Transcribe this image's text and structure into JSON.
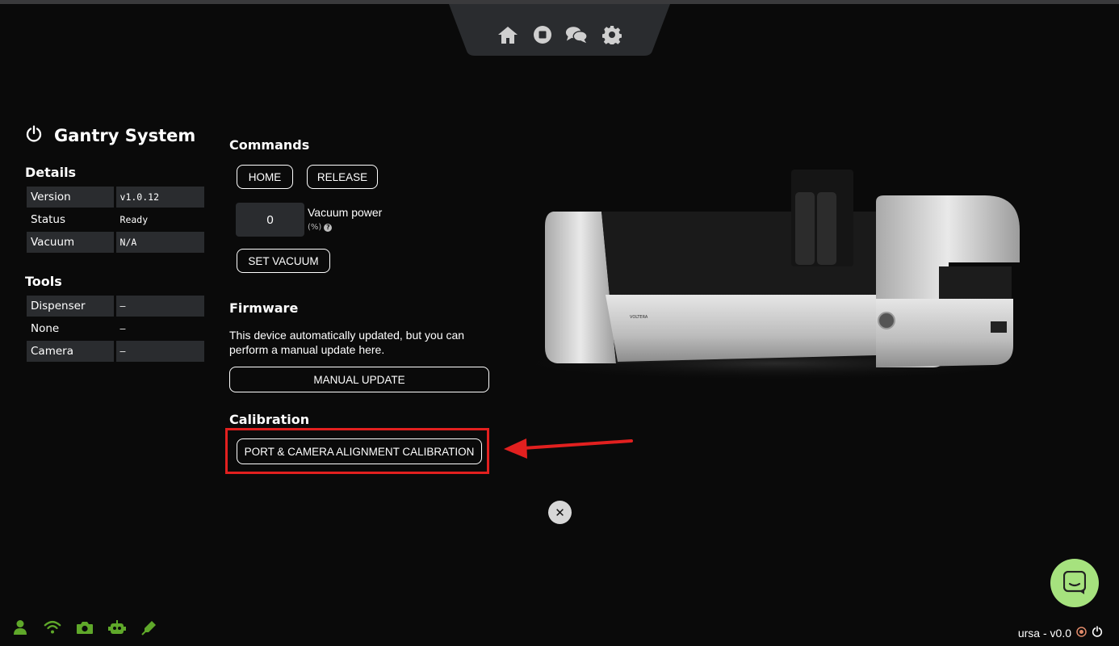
{
  "nav": {
    "icons": [
      "home-icon",
      "stop-icon",
      "chat-icon",
      "gear-icon"
    ]
  },
  "page": {
    "title": "Gantry System"
  },
  "details": {
    "heading": "Details",
    "rows": [
      {
        "label": "Version",
        "value": "v1.0.12"
      },
      {
        "label": "Status",
        "value": "Ready"
      },
      {
        "label": "Vacuum",
        "value": "N/A"
      }
    ]
  },
  "tools": {
    "heading": "Tools",
    "rows": [
      {
        "label": "Dispenser",
        "value": "–"
      },
      {
        "label": "None",
        "value": "–"
      },
      {
        "label": "Camera",
        "value": "–"
      }
    ]
  },
  "commands": {
    "heading": "Commands",
    "home_label": "HOME",
    "release_label": "RELEASE",
    "vacuum_value": "0",
    "vacuum_label": "Vacuum power",
    "vacuum_unit": "(%)",
    "set_vacuum_label": "SET VACUUM"
  },
  "firmware": {
    "heading": "Firmware",
    "text": "This device automatically updated, but you can perform a manual update here.",
    "manual_update_label": "MANUAL UPDATE"
  },
  "calibration": {
    "heading": "Calibration",
    "button_label": "PORT & CAMERA ALIGNMENT CALIBRATION"
  },
  "footer": {
    "user_text": "ursa - v0.0"
  },
  "colors": {
    "background": "#0a0a0a",
    "accent_green": "#5fa82a",
    "highlight_red": "#e2201f",
    "chat_fab": "#a6e27e"
  }
}
